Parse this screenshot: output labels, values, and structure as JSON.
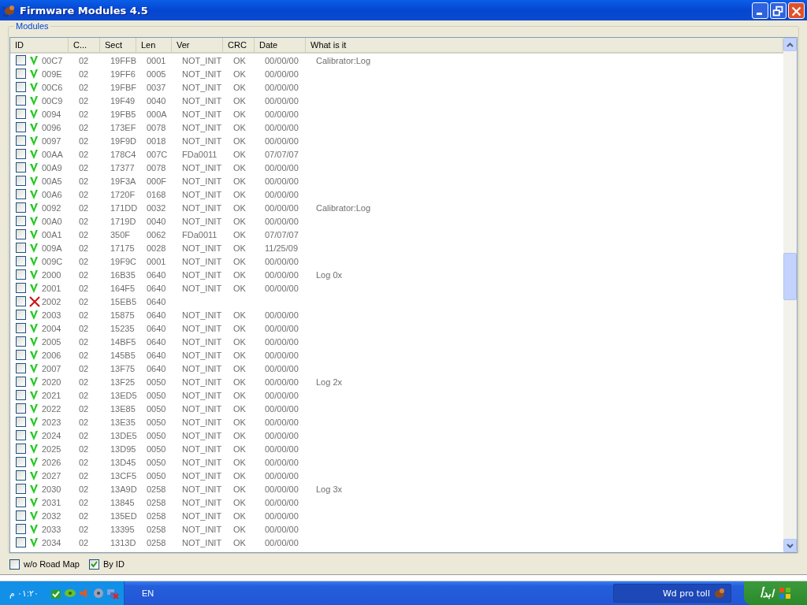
{
  "window": {
    "title": "Firmware Modules 4.5"
  },
  "group": {
    "title": "Modules"
  },
  "table": {
    "columns": [
      "ID",
      "C...",
      "Sect",
      "Len",
      "Ver",
      "CRC",
      "Date",
      "What is it"
    ],
    "rows": [
      {
        "checked": false,
        "passed": true,
        "cells": [
          "00C7",
          "02",
          "19FFB",
          "0001",
          "NOT_INIT",
          "OK",
          "00/00/00",
          "Calibrator:Log"
        ]
      },
      {
        "checked": false,
        "passed": true,
        "cells": [
          "009E",
          "02",
          "19FF6",
          "0005",
          "NOT_INIT",
          "OK",
          "00/00/00"
        ]
      },
      {
        "checked": false,
        "passed": true,
        "cells": [
          "00C6",
          "02",
          "19FBF",
          "0037",
          "NOT_INIT",
          "OK",
          "00/00/00"
        ]
      },
      {
        "checked": false,
        "passed": true,
        "cells": [
          "00C9",
          "02",
          "19F49",
          "0040",
          "NOT_INIT",
          "OK",
          "00/00/00"
        ]
      },
      {
        "checked": false,
        "passed": true,
        "cells": [
          "0094",
          "02",
          "19FB5",
          "000A",
          "NOT_INIT",
          "OK",
          "00/00/00"
        ]
      },
      {
        "checked": false,
        "passed": true,
        "cells": [
          "0096",
          "02",
          "173EF",
          "0078",
          "NOT_INIT",
          "OK",
          "00/00/00"
        ]
      },
      {
        "checked": false,
        "passed": true,
        "cells": [
          "0097",
          "02",
          "19F9D",
          "0018",
          "NOT_INIT",
          "OK",
          "00/00/00"
        ]
      },
      {
        "checked": false,
        "passed": true,
        "cells": [
          "00AA",
          "02",
          "178C4",
          "007C",
          "FDa0011",
          "OK",
          "07/07/07"
        ]
      },
      {
        "checked": false,
        "passed": true,
        "cells": [
          "00A9",
          "02",
          "17377",
          "0078",
          "NOT_INIT",
          "OK",
          "00/00/00"
        ]
      },
      {
        "checked": false,
        "passed": true,
        "cells": [
          "00A5",
          "02",
          "19F3A",
          "000F",
          "NOT_INIT",
          "OK",
          "00/00/00"
        ]
      },
      {
        "checked": false,
        "passed": true,
        "cells": [
          "00A6",
          "02",
          "1720F",
          "0168",
          "NOT_INIT",
          "OK",
          "00/00/00"
        ]
      },
      {
        "checked": false,
        "passed": true,
        "cells": [
          "0092",
          "02",
          "171DD",
          "0032",
          "NOT_INIT",
          "OK",
          "00/00/00",
          "Calibrator:Log"
        ]
      },
      {
        "checked": false,
        "passed": true,
        "cells": [
          "00A0",
          "02",
          "1719D",
          "0040",
          "NOT_INIT",
          "OK",
          "00/00/00"
        ]
      },
      {
        "checked": false,
        "passed": true,
        "cells": [
          "00A1",
          "02",
          "350F",
          "0062",
          "FDa0011",
          "OK",
          "07/07/07"
        ]
      },
      {
        "checked": false,
        "passed": true,
        "cells": [
          "009A",
          "02",
          "17175",
          "0028",
          "NOT_INIT",
          "OK",
          "11/25/09"
        ]
      },
      {
        "checked": false,
        "passed": true,
        "cells": [
          "009C",
          "02",
          "19F9C",
          "0001",
          "NOT_INIT",
          "OK",
          "00/00/00"
        ]
      },
      {
        "checked": false,
        "passed": true,
        "cells": [
          "2000",
          "02",
          "16B35",
          "0640",
          "NOT_INIT",
          "OK",
          "00/00/00",
          "Log 0x"
        ]
      },
      {
        "checked": false,
        "passed": true,
        "cells": [
          "2001",
          "02",
          "164F5",
          "0640",
          "NOT_INIT",
          "OK",
          "00/00/00"
        ]
      },
      {
        "checked": false,
        "passed": false,
        "cells": [
          "2002",
          "02",
          "15EB5",
          "0640"
        ]
      },
      {
        "checked": false,
        "passed": true,
        "cells": [
          "2003",
          "02",
          "15875",
          "0640",
          "NOT_INIT",
          "OK",
          "00/00/00"
        ]
      },
      {
        "checked": false,
        "passed": true,
        "cells": [
          "2004",
          "02",
          "15235",
          "0640",
          "NOT_INIT",
          "OK",
          "00/00/00"
        ]
      },
      {
        "checked": false,
        "passed": true,
        "cells": [
          "2005",
          "02",
          "14BF5",
          "0640",
          "NOT_INIT",
          "OK",
          "00/00/00"
        ]
      },
      {
        "checked": false,
        "passed": true,
        "cells": [
          "2006",
          "02",
          "145B5",
          "0640",
          "NOT_INIT",
          "OK",
          "00/00/00"
        ]
      },
      {
        "checked": false,
        "passed": true,
        "cells": [
          "2007",
          "02",
          "13F75",
          "0640",
          "NOT_INIT",
          "OK",
          "00/00/00"
        ]
      },
      {
        "checked": false,
        "passed": true,
        "cells": [
          "2020",
          "02",
          "13F25",
          "0050",
          "NOT_INIT",
          "OK",
          "00/00/00",
          "Log 2x"
        ]
      },
      {
        "checked": false,
        "passed": true,
        "cells": [
          "2021",
          "02",
          "13ED5",
          "0050",
          "NOT_INIT",
          "OK",
          "00/00/00"
        ]
      },
      {
        "checked": false,
        "passed": true,
        "cells": [
          "2022",
          "02",
          "13E85",
          "0050",
          "NOT_INIT",
          "OK",
          "00/00/00"
        ]
      },
      {
        "checked": false,
        "passed": true,
        "cells": [
          "2023",
          "02",
          "13E35",
          "0050",
          "NOT_INIT",
          "OK",
          "00/00/00"
        ]
      },
      {
        "checked": false,
        "passed": true,
        "cells": [
          "2024",
          "02",
          "13DE5",
          "0050",
          "NOT_INIT",
          "OK",
          "00/00/00"
        ]
      },
      {
        "checked": false,
        "passed": true,
        "cells": [
          "2025",
          "02",
          "13D95",
          "0050",
          "NOT_INIT",
          "OK",
          "00/00/00"
        ]
      },
      {
        "checked": false,
        "passed": true,
        "cells": [
          "2026",
          "02",
          "13D45",
          "0050",
          "NOT_INIT",
          "OK",
          "00/00/00"
        ]
      },
      {
        "checked": false,
        "passed": true,
        "cells": [
          "2027",
          "02",
          "13CF5",
          "0050",
          "NOT_INIT",
          "OK",
          "00/00/00"
        ]
      },
      {
        "checked": false,
        "passed": true,
        "cells": [
          "2030",
          "02",
          "13A9D",
          "0258",
          "NOT_INIT",
          "OK",
          "00/00/00",
          "Log 3x"
        ]
      },
      {
        "checked": false,
        "passed": true,
        "cells": [
          "2031",
          "02",
          "13845",
          "0258",
          "NOT_INIT",
          "OK",
          "00/00/00"
        ]
      },
      {
        "checked": false,
        "passed": true,
        "cells": [
          "2032",
          "02",
          "135ED",
          "0258",
          "NOT_INIT",
          "OK",
          "00/00/00"
        ]
      },
      {
        "checked": false,
        "passed": true,
        "cells": [
          "2033",
          "02",
          "13395",
          "0258",
          "NOT_INIT",
          "OK",
          "00/00/00"
        ]
      },
      {
        "checked": false,
        "passed": true,
        "cells": [
          "2034",
          "02",
          "1313D",
          "0258",
          "NOT_INIT",
          "OK",
          "00/00/00"
        ]
      }
    ]
  },
  "options": [
    {
      "label": "w/o Road Map",
      "checked": false
    },
    {
      "label": "By ID",
      "checked": true
    }
  ],
  "taskbar": {
    "clock": "٠١:٢٠ م",
    "language": "EN",
    "task": "Wd pro toll",
    "start": "ابدأ"
  }
}
